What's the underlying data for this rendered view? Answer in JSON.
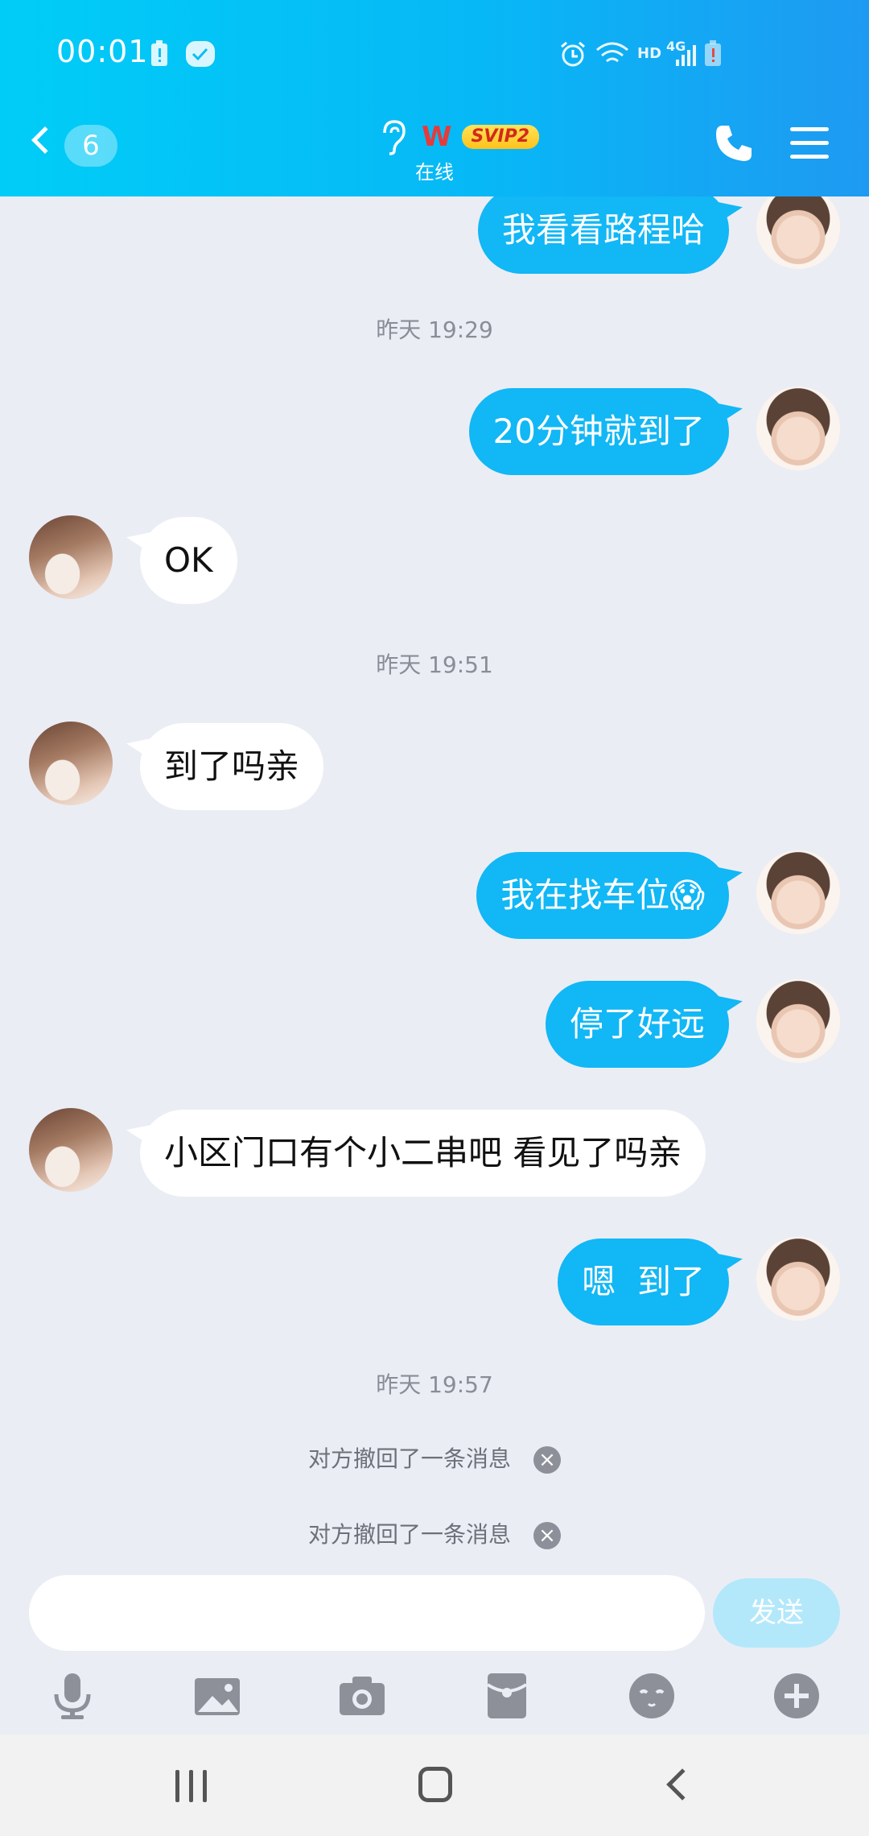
{
  "status_bar": {
    "time": "00:01",
    "network": "4G",
    "hd": "HD"
  },
  "header": {
    "unread_count": "6",
    "contact_name": "W",
    "badge": "SVIP2",
    "status": "在线"
  },
  "messages": [
    {
      "side": "me",
      "text": "我看看路程哈"
    },
    {
      "type": "timestamp",
      "text": "昨天 19:29"
    },
    {
      "side": "me",
      "text": "20分钟就到了"
    },
    {
      "side": "other",
      "text": "OK"
    },
    {
      "type": "timestamp",
      "text": "昨天 19:51"
    },
    {
      "side": "other",
      "text": "到了吗亲"
    },
    {
      "side": "me",
      "text": "我在找车位😱"
    },
    {
      "side": "me",
      "text": "停了好远"
    },
    {
      "side": "other",
      "text": "小区门口有个小二串吧 看见了吗亲"
    },
    {
      "side": "me",
      "text": "嗯  到了"
    },
    {
      "type": "timestamp",
      "text": "昨天 19:57"
    },
    {
      "type": "recall",
      "text": "对方撤回了一条消息"
    },
    {
      "type": "recall",
      "text": "对方撤回了一条消息"
    }
  ],
  "input": {
    "placeholder": "",
    "send_label": "发送"
  },
  "toolbar": [
    "microphone-icon",
    "image-icon",
    "camera-icon",
    "red-packet-icon",
    "emoji-icon",
    "plus-icon"
  ]
}
